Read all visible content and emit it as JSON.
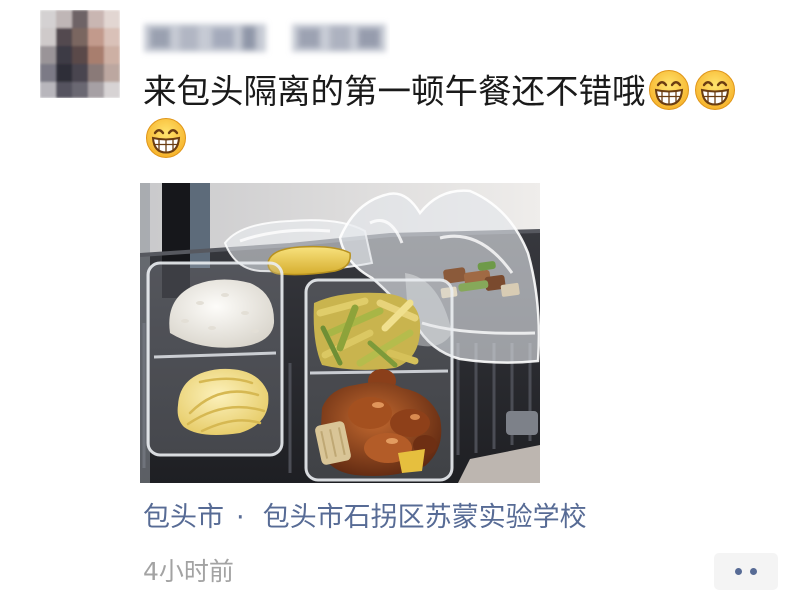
{
  "post": {
    "text": "来包头隔离的第一顿午餐还不错哦",
    "emoji": [
      "grinning-face",
      "grinning-face",
      "grinning-face"
    ]
  },
  "location": {
    "city": "包头市",
    "separator": "·",
    "place": "包头市石拐区苏蒙实验学校"
  },
  "timestamp": "4小时前",
  "comment_button": {
    "icon": "more-dots"
  },
  "colors": {
    "link": "#576b95",
    "timestamp": "#a3a3a3",
    "text": "#1a1a1a",
    "comment_button_bg": "#f4f4f4"
  }
}
